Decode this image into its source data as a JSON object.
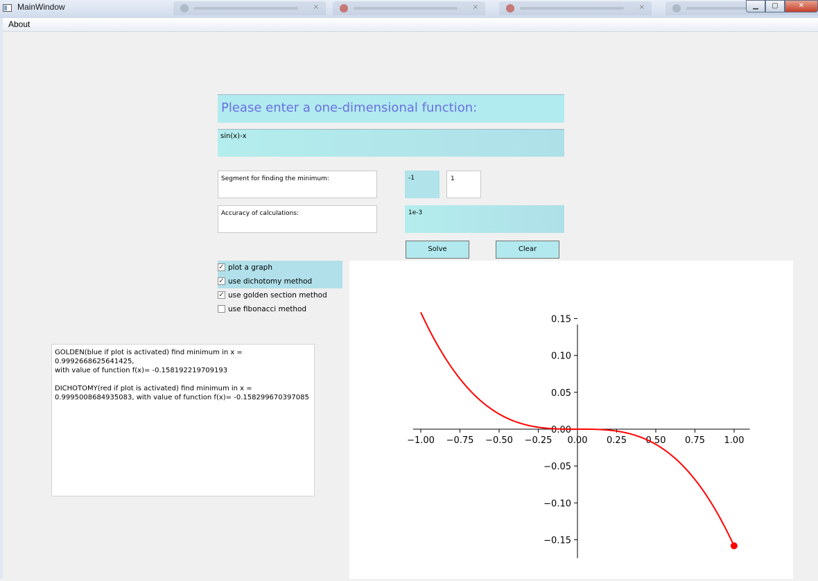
{
  "window": {
    "title": "MainWindow",
    "controls": {
      "minimize": "▁",
      "maximize": "▢",
      "close": "✕"
    }
  },
  "menu": {
    "about": "About"
  },
  "form": {
    "header": "Please enter a one-dimensional function:",
    "function_value": "sin(x)-x",
    "segment_label": "Segment for finding the minimum:",
    "segment_low": "-1",
    "segment_high": "1",
    "accuracy_label": "Accuracy of calculations:",
    "accuracy_value": "1e-3",
    "solve_label": "Solve",
    "clear_label": "Clear"
  },
  "options": [
    {
      "label": "plot a graph",
      "checked": true
    },
    {
      "label": "use dichotomy method",
      "checked": true
    },
    {
      "label": "use golden section method",
      "checked": true
    },
    {
      "label": "use fibonacci method",
      "checked": false
    }
  ],
  "result_text": "GOLDEN(blue if plot is activated) find minimum in x = 0.9992668625641425,\nwith value of function f(x)= -0.158192219709193\n\nDICHOTOMY(red if plot is activated) find minimum in x =\n0.9995008684935083, with value of function f(x)= -0.158299670397085",
  "chart_data": {
    "type": "line",
    "function": "sin(x)-x",
    "xlim": [
      -1.05,
      1.1
    ],
    "ylim": [
      -0.175,
      0.175
    ],
    "x_ticks": [
      "−1.00",
      "−0.75",
      "−0.50",
      "−0.25",
      "0.00",
      "0.25",
      "0.50",
      "0.75",
      "1.00"
    ],
    "x_tick_values": [
      -1.0,
      -0.75,
      -0.5,
      -0.25,
      0.0,
      0.25,
      0.5,
      0.75,
      1.0
    ],
    "y_ticks": [
      "0.15",
      "0.10",
      "0.05",
      "0.00",
      "−0.05",
      "−0.10",
      "−0.15"
    ],
    "y_tick_values": [
      0.15,
      0.1,
      0.05,
      0.0,
      -0.05,
      -0.1,
      -0.15
    ],
    "series": [
      {
        "color": "#ff0000",
        "x": [
          -1.0,
          -0.9,
          -0.8,
          -0.7,
          -0.6,
          -0.5,
          -0.4,
          -0.3,
          -0.2,
          -0.1,
          0.0,
          0.1,
          0.2,
          0.3,
          0.4,
          0.5,
          0.6,
          0.7,
          0.8,
          0.9,
          1.0
        ],
        "y": [
          0.1585,
          0.1167,
          0.0827,
          0.0558,
          0.0354,
          0.0206,
          0.0106,
          0.0045,
          0.0013,
          0.0002,
          0.0,
          -0.0002,
          -0.0013,
          -0.0045,
          -0.0106,
          -0.0206,
          -0.0354,
          -0.0558,
          -0.0827,
          -0.1167,
          -0.1585
        ]
      }
    ],
    "minimum_point": {
      "x": 0.9995,
      "y": -0.1583,
      "color": "#ff0000"
    },
    "grid": false
  }
}
